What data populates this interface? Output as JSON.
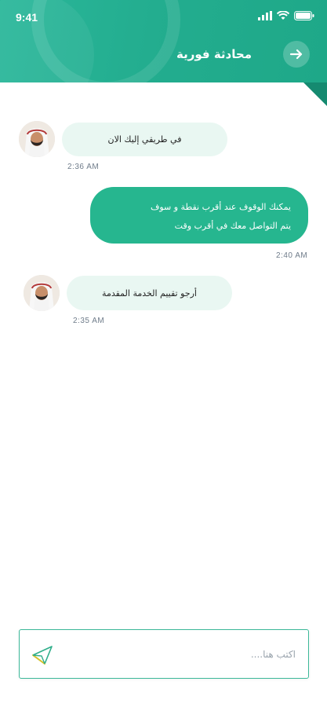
{
  "status_bar": {
    "time": "9:41"
  },
  "header": {
    "title": "محادثة فورية",
    "back_icon": "arrow-right-icon"
  },
  "messages": [
    {
      "direction": "incoming",
      "text": "في طريقي إليك الان",
      "time": "2:36  AM"
    },
    {
      "direction": "outgoing",
      "lines": [
        "يمكنك الوقوف عند أقرب نقطة و سوف",
        "يتم التواصل معك في أقرب وقت"
      ],
      "time": "2:40  AM"
    },
    {
      "direction": "incoming",
      "text": "أرجو تقييم الخدمة المقدمة",
      "time": "2:35  AM"
    }
  ],
  "composer": {
    "placeholder": "اكتب هنا....",
    "value": "",
    "send_icon": "send-icon"
  },
  "colors": {
    "accent": "#26b68f",
    "incoming_bubble": "#e9f7f2"
  }
}
